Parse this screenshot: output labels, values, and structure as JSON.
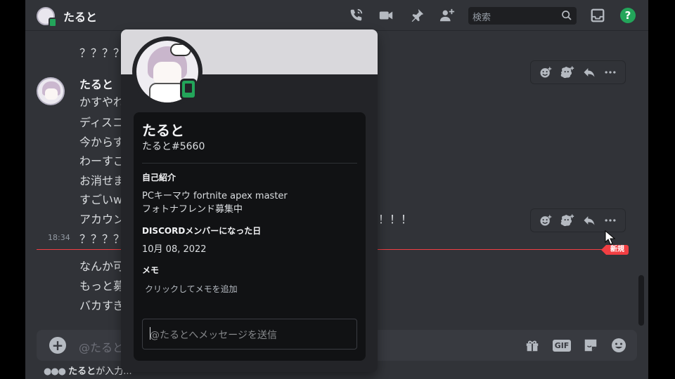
{
  "header": {
    "title": "たると",
    "search_placeholder": "検索"
  },
  "messages": {
    "author": "たると",
    "top_line": "？？？？",
    "lines": [
      "かすやれ",
      "ディスコ",
      "今からす",
      "わーすご",
      "お消せま",
      "すごいw",
      "アカウン"
    ],
    "tail_fragment": "！！！",
    "highlighted_line": "？？？？",
    "timestamp": "18:34",
    "after_new": [
      "なんか可",
      "もっと募",
      "バカすぎ"
    ]
  },
  "new_marker": "新規",
  "composer": {
    "placeholder": "@たると"
  },
  "typing": {
    "name": "たると",
    "suffix": "が入力..."
  },
  "profile": {
    "display_name": "たると",
    "tag": "たると#5660",
    "about_heading": "自己紹介",
    "about_lines": [
      "PCキーマウ fortnite apex master",
      "フォトナフレンド募集中"
    ],
    "member_since_heading": "DISCORDメンバーになった日",
    "member_since": "10月 08, 2022",
    "note_heading": "メモ",
    "note_placeholder": "クリックしてメモを追加",
    "dm_placeholder": "@たるとへメッセージを送信"
  },
  "colors": {
    "accent_green": "#23a55a",
    "new_red": "#f23f43",
    "background": "#313338"
  }
}
